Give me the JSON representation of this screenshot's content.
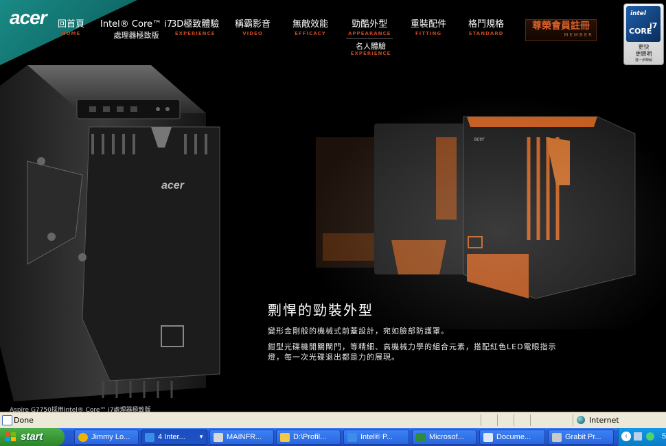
{
  "brand": {
    "logo": "acer"
  },
  "nav": {
    "items": [
      {
        "zh": "回首頁",
        "en": "HOME"
      },
      {
        "zh": "Intel® Core™ i7",
        "en": "處理器極致版"
      },
      {
        "zh": "3D極致體驗",
        "en": "EXPERIENCE"
      },
      {
        "zh": "稱霸影音",
        "en": "VIDEO"
      },
      {
        "zh": "無敵效能",
        "en": "EFFICACY"
      },
      {
        "zh": "勁酷外型",
        "en": "APPEARANCE"
      },
      {
        "zh": "重裝配件",
        "en": "FITTING"
      },
      {
        "zh": "格鬥規格",
        "en": "STANDARD"
      }
    ],
    "sub": {
      "zh": "名人體驗",
      "en": "EXPERIENCE"
    },
    "member": {
      "zh": "尊榮會員註冊",
      "en": "MEMBER"
    }
  },
  "intel_badge": {
    "brand": "intel",
    "core": "CORE",
    "model": "i7",
    "line1": "更快",
    "line2": "更聰明",
    "line3": "進一步瞭解"
  },
  "hero": {
    "title": "剽悍的勁裝外型",
    "p1": "變形金剛般的機械式前蓋設計，宛如臉部防護罩。",
    "p2": "鉗型光碟機開關閘門，等精細、高機械力學的組合元素，搭配紅色LED電眼指示燈，每一次光碟退出都是力的展現。"
  },
  "footnote": "Aspire G7750採用Intel® Core™ i7處理器極致版",
  "status": {
    "text": "Done",
    "zone": "Internet"
  },
  "taskbar": {
    "start": "start",
    "buttons": [
      {
        "label": "Jimmy Lo...",
        "icon_color": "#f0b400"
      },
      {
        "label": "4 Inter...",
        "icon_color": "#3b8ee8"
      },
      {
        "label": "MAINFR...",
        "icon_color": "#d8d8d8"
      },
      {
        "label": "D:\\Profil...",
        "icon_color": "#f1c94a"
      },
      {
        "label": "Intel® P...",
        "icon_color": "#3b8ee8"
      },
      {
        "label": "Microsof...",
        "icon_color": "#2e8b3a"
      },
      {
        "label": "Docume...",
        "icon_color": "#dfe6f5"
      },
      {
        "label": "Grabit Pr...",
        "icon_color": "#c9c9c9"
      }
    ],
    "clock": "5"
  },
  "colors": {
    "accent_orange": "#c2461c",
    "teal": "#1a8a86",
    "taskbar_blue": "#245edb",
    "start_green": "#3a9a36"
  }
}
